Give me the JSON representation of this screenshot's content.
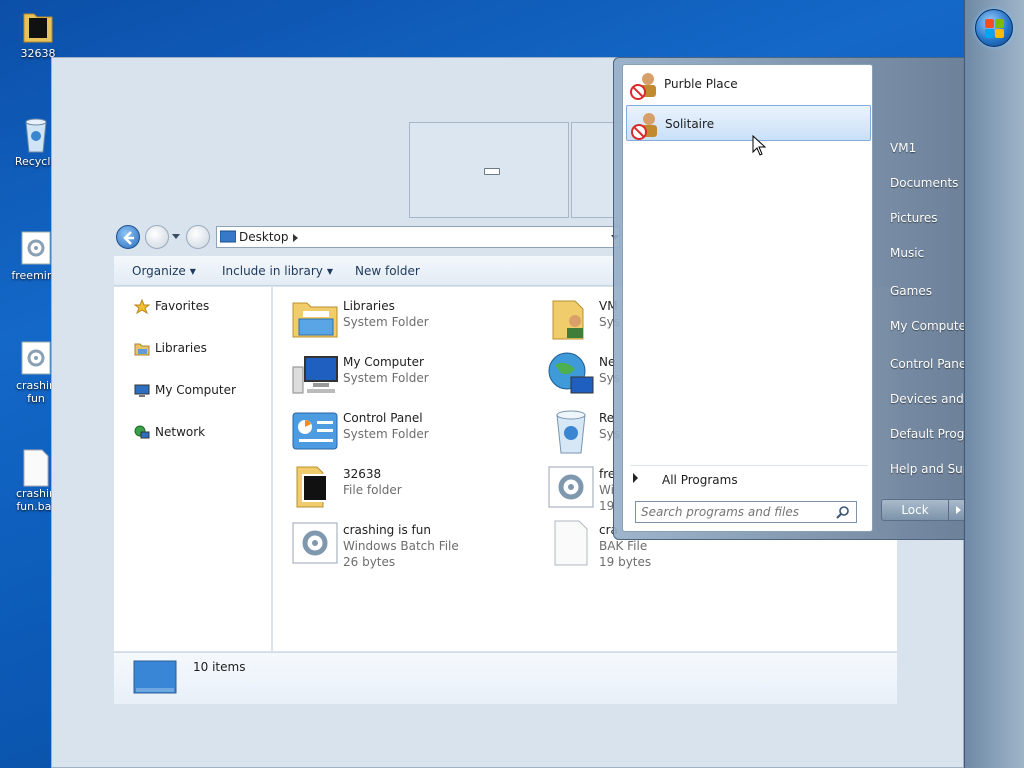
{
  "desktop": {
    "icons": [
      {
        "label": "32638"
      },
      {
        "label": "Recycle"
      },
      {
        "label": "freemine"
      },
      {
        "label": "crashin",
        "label2": "fun"
      },
      {
        "label": "crashin",
        "label2": "fun.bat"
      }
    ]
  },
  "explorer": {
    "address": "Desktop",
    "toolbar": {
      "organize": "Organize",
      "include": "Include in library",
      "new_folder": "New folder"
    },
    "nav": [
      "Favorites",
      "Libraries",
      "My Computer",
      "Network"
    ],
    "items": [
      {
        "name": "Libraries",
        "type": "System Folder",
        "icon": "libraries-icon"
      },
      {
        "name": "VM",
        "type": "Sys",
        "icon": "user-folder-icon"
      },
      {
        "name": "My Computer",
        "type": "System Folder",
        "icon": "computer-icon"
      },
      {
        "name": "Ne",
        "type": "Sys",
        "icon": "network-icon"
      },
      {
        "name": "Control Panel",
        "type": "System Folder",
        "icon": "control-panel-icon"
      },
      {
        "name": "Re",
        "type": "Sys",
        "icon": "recycle-bin-icon"
      },
      {
        "name": "32638",
        "type": "File folder",
        "icon": "folder-icon"
      },
      {
        "name": "fre",
        "type": "Wi",
        "size": "19",
        "icon": "batch-file-icon"
      },
      {
        "name": "crashing is fun",
        "type": "Windows Batch File",
        "size": "26 bytes",
        "icon": "batch-file-icon"
      },
      {
        "name": "cra",
        "type": "BAK File",
        "size": "19 bytes",
        "icon": "blank-file-icon"
      }
    ],
    "status_count": "10 items"
  },
  "start_menu": {
    "programs": [
      {
        "label": "Purble Place"
      },
      {
        "label": "Solitaire"
      }
    ],
    "all_programs": "All Programs",
    "search_placeholder": "Search programs and files",
    "right_items": [
      "VM1",
      "Documents",
      "Pictures",
      "Music",
      "Games",
      "My Computer",
      "Control Panel",
      "Devices and Printers",
      "Default Programs",
      "Help and Support"
    ],
    "lock_label": "Lock"
  },
  "colors": {
    "desktop_bg": "#1468c8",
    "selection": "#c9e0f7"
  }
}
